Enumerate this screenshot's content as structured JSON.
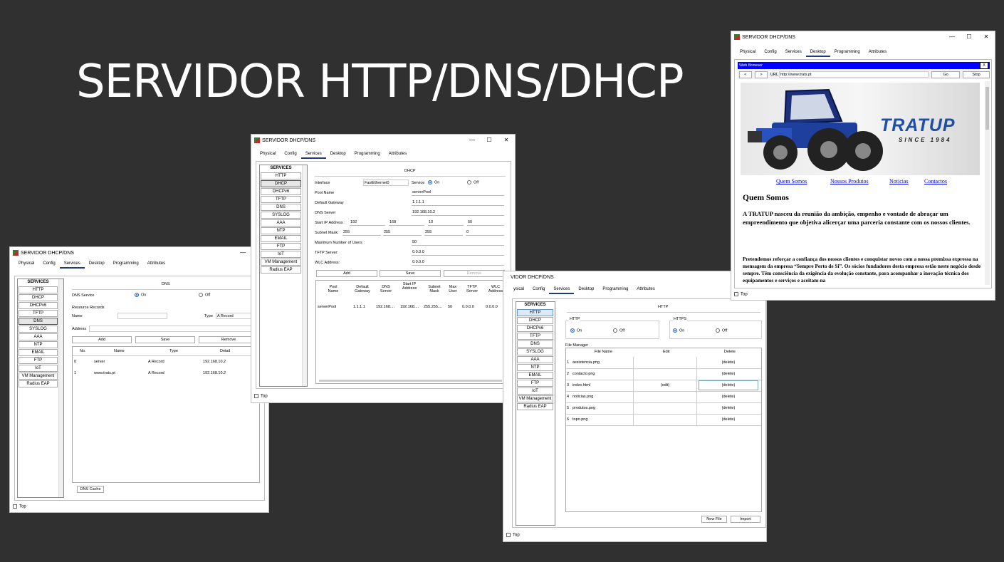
{
  "slide_title": "SERVIDOR HTTP/DNS/DHCP",
  "window_title": "SERVIDOR DHCP/DNS",
  "window_controls": {
    "minimize": "—",
    "maximize": "☐",
    "close": "✕"
  },
  "tabs": [
    "Physical",
    "Config",
    "Services",
    "Desktop",
    "Programming",
    "Attributes"
  ],
  "http_window_tabs": [
    "ysical",
    "Config",
    "Services",
    "Desktop",
    "Programming",
    "Attributes"
  ],
  "http_window_title": "VIDOR DHCP/DNS",
  "services_header": "SERVICES",
  "services": [
    "HTTP",
    "DHCP",
    "DHCPv6",
    "TFTP",
    "DNS",
    "SYSLOG",
    "AAA",
    "NTP",
    "EMAIL",
    "FTP",
    "IoT",
    "VM Management",
    "Radius EAP"
  ],
  "http_services": [
    "HTTP",
    "DHCP",
    "DHCPv6",
    "TFTP",
    "DNS",
    "SYSLOG",
    "AAA",
    "NTP",
    "EMAIL",
    "FTP",
    "IoT",
    "VM Management",
    "Radius EAP"
  ],
  "top_label": "Top",
  "dns": {
    "heading": "DNS",
    "service_label": "DNS Service",
    "on": "On",
    "off": "Off",
    "resource_records": "Resource Records",
    "name_label": "Name",
    "type_label": "Type",
    "type_value": "A Record",
    "address_label": "Address",
    "add": "Add",
    "save": "Save",
    "remove": "Remove",
    "columns": [
      "No.",
      "Name",
      "Type",
      "Detail"
    ],
    "rows": [
      {
        "no": "0",
        "name": "server",
        "type": "A Record",
        "detail": "192.168.10.2"
      },
      {
        "no": "1",
        "name": "www.trats.pt",
        "type": "A Record",
        "detail": "192.168.10.2"
      }
    ],
    "cache_button": "DNS Cache"
  },
  "dhcp": {
    "heading": "DHCP",
    "interface_label": "Interface",
    "interface_value": "FastEthernet0",
    "service_label": "Service",
    "on": "On",
    "off": "Off",
    "pool_name_label": "Pool Name",
    "pool_name": "serverPool",
    "gateway_label": "Default Gateway",
    "gateway": "1.1.1.1",
    "dns_label": "DNS Server",
    "dns": "192.168.10.2",
    "start_ip_label": "Start IP Address :",
    "start_ip": [
      "192",
      "168",
      "10",
      "50"
    ],
    "subnet_label": "Subnet Mask:",
    "subnet": [
      "255",
      "255",
      "255",
      "0"
    ],
    "max_users_label": "Maximum Number of Users :",
    "max_users": "50",
    "tftp_label": "TFTP Server:",
    "tftp": "0.0.0.0",
    "wlc_label": "WLC Address:",
    "wlc": "0.0.0.0",
    "add": "Add",
    "save": "Save",
    "remove": "Remove",
    "columns": [
      "Pool Name",
      "Default Gateway",
      "DNS Server",
      "Start IP Address",
      "Subnet Mask",
      "Max User",
      "TFTP Server",
      "WLC Address"
    ],
    "row": [
      "serverPool",
      "1.1.1.1",
      "192.168....",
      "192.168....",
      "255.255....",
      "50",
      "0.0.0.0",
      "0.0.0.0"
    ]
  },
  "http": {
    "heading": "HTTP",
    "http_group": "HTTP",
    "https_group": "HTTPS",
    "on": "On",
    "off": "Off",
    "file_manager": "File Manager",
    "columns": [
      "File Name",
      "Edit",
      "Delete"
    ],
    "files": [
      {
        "no": "1",
        "name": "assistencia.png",
        "edit": "",
        "delete": "(delete)"
      },
      {
        "no": "2",
        "name": "contacto.png",
        "edit": "",
        "delete": "(delete)"
      },
      {
        "no": "3",
        "name": "index.html",
        "edit": "(edit)",
        "delete": "(delete)"
      },
      {
        "no": "4",
        "name": "noticias.png",
        "edit": "",
        "delete": "(delete)"
      },
      {
        "no": "5",
        "name": "produtos.png",
        "edit": "",
        "delete": "(delete)"
      },
      {
        "no": "6",
        "name": "topo.png",
        "edit": "",
        "delete": "(delete)"
      }
    ],
    "new_file": "New File",
    "import": "Import"
  },
  "browser": {
    "title": "Web Browser",
    "close": "X",
    "back": "<",
    "forward": ">",
    "url_label": "URL",
    "url": "http://www.trats.pt",
    "go": "Go",
    "stop": "Stop",
    "brand": "TRATUP",
    "since": "SINCE 1984",
    "nav": [
      "Quem Somos",
      "Nossos Produtos",
      "Notícias",
      "Contactos"
    ],
    "heading": "Quem Somos",
    "para1": "A TRATUP nasceu da reunião da ambição, empenho e vontade de abraçar um empreendimento que objetiva alicerçar uma parceria constante com os nossos clientes.",
    "para2": "Pretendemos reforçar a confiança dos nossos clientes e conquistar novos com a nossa premissa expressa na mensagem da empresa “Sempre Perto de Si”. Os sócios fundadores desta empresa estão neste negócio desde sempre. Têm consciência da exigência da evolução constante, para acompanhar a inovação técnica dos equipamentos e serviços e aceitam-na"
  },
  "colors": {
    "background": "#303030",
    "accent": "#1f5bd8",
    "browser_bar": "#0000ff",
    "brand": "#1e4fa8"
  }
}
